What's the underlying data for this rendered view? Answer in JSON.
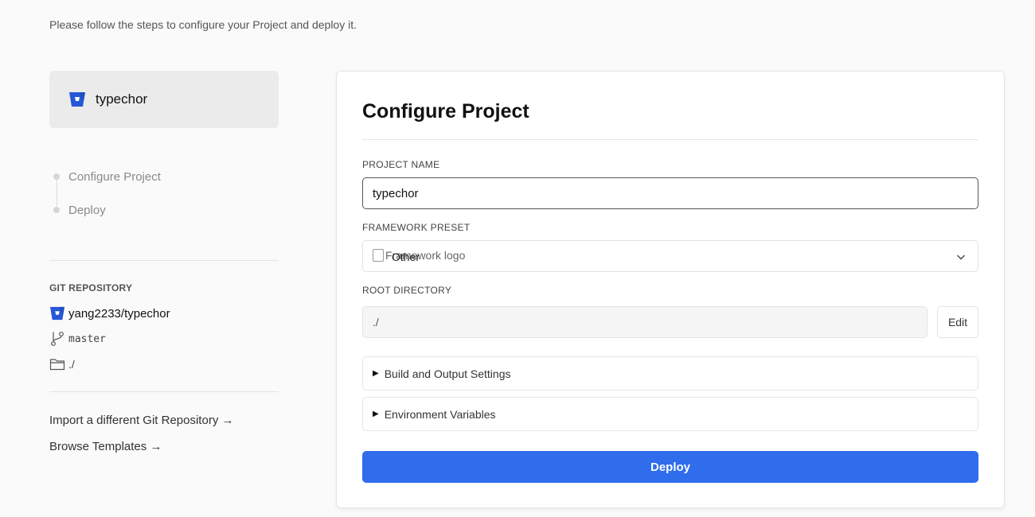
{
  "intro": "Please follow the steps to configure your Project and deploy it.",
  "repo_card": {
    "name": "typechor",
    "icon": "bitbucket-icon"
  },
  "steps": [
    "Configure Project",
    "Deploy"
  ],
  "git": {
    "title": "GIT REPOSITORY",
    "repo": "yang2233/typechor",
    "branch": "master",
    "directory": "./"
  },
  "links": {
    "import": "Import a different Git Repository →",
    "templates": "Browse Templates →"
  },
  "configure": {
    "title": "Configure Project",
    "project_name_label": "PROJECT NAME",
    "project_name_value": "typechor",
    "framework_label": "FRAMEWORK PRESET",
    "framework_img_alt": "Framework logo",
    "framework_value": "Other",
    "root_label": "ROOT DIRECTORY",
    "root_value": "./",
    "edit_label": "Edit",
    "build_settings": "Build and Output Settings",
    "env_vars": "Environment Variables",
    "deploy_label": "Deploy"
  },
  "colors": {
    "accent": "#2f6ded",
    "bitbucket": "#2557d6"
  }
}
